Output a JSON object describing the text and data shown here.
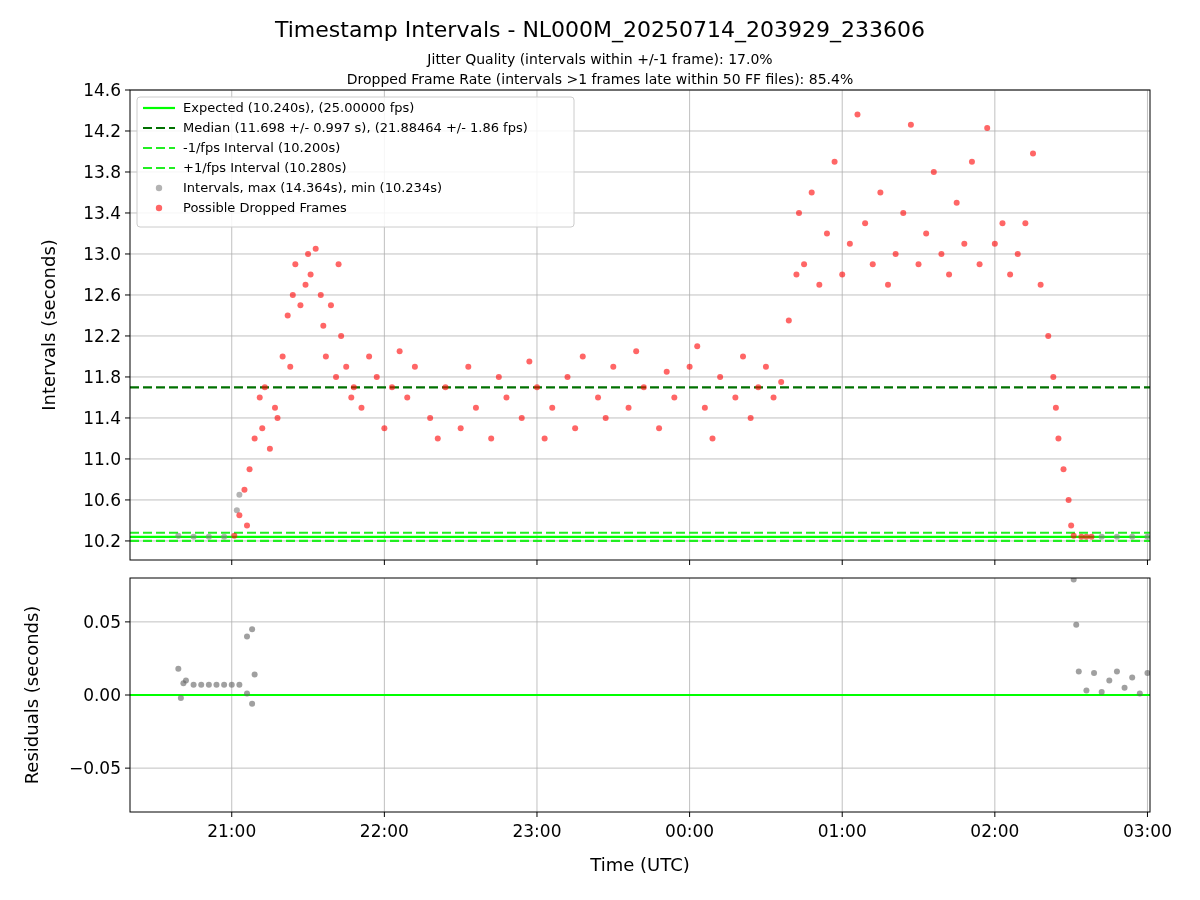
{
  "figure": {
    "title": "Timestamp Intervals - NL000M_20250714_203929_233606",
    "subtitles": [
      "Jitter Quality (intervals within +/-1 frame): 17.0%",
      "Dropped Frame Rate (intervals >1 frames late within 50 FF files): 85.4%"
    ]
  },
  "charts": [
    {
      "chart_data": {
        "type": "scatter",
        "ylabel": "Intervals (seconds)",
        "grid": true,
        "xlim": [
          "2025-07-14T20:20",
          "2025-07-15T03:01"
        ],
        "ylim": [
          10.014,
          14.6
        ],
        "yticks": [
          {
            "value": 10.2,
            "label": "10.2"
          },
          {
            "value": 10.6,
            "label": "10.6"
          },
          {
            "value": 11.0,
            "label": "11.0"
          },
          {
            "value": 11.4,
            "label": "11.4"
          },
          {
            "value": 11.8,
            "label": "11.8"
          },
          {
            "value": 12.2,
            "label": "12.2"
          },
          {
            "value": 12.6,
            "label": "12.6"
          },
          {
            "value": 13.0,
            "label": "13.0"
          },
          {
            "value": 13.4,
            "label": "13.4"
          },
          {
            "value": 13.8,
            "label": "13.8"
          },
          {
            "value": 14.2,
            "label": "14.2"
          },
          {
            "value": 14.6,
            "label": "14.6"
          }
        ],
        "ref_lines": [
          {
            "axis": "y",
            "value": 10.24,
            "label": "Expected (10.240s), (25.00000 fps)",
            "color": "#00ff00"
          },
          {
            "axis": "y",
            "value": 11.698,
            "label": "Median (11.698 +/- 0.997 s), (21.88464 +/- 1.86 fps)",
            "color": "#007000"
          },
          {
            "axis": "y",
            "value": 10.2,
            "label": "-1/fps Interval (10.200s)",
            "color": "#22ee22"
          },
          {
            "axis": "y",
            "value": 10.28,
            "label": "+1/fps Interval (10.280s)",
            "color": "#22ee22"
          }
        ],
        "series": [
          {
            "name": "Intervals, max (14.364s), min (10.234s)",
            "color": "#808080",
            "x": [
              "2025-07-14T20:39",
              "2025-07-14T20:45",
              "2025-07-14T20:51",
              "2025-07-14T20:57",
              "2025-07-14T21:02",
              "2025-07-14T21:03",
              "2025-07-15T02:42",
              "2025-07-15T02:48",
              "2025-07-15T02:54",
              "2025-07-15T03:00"
            ],
            "values": [
              10.25,
              10.24,
              10.24,
              10.24,
              10.5,
              10.65,
              10.24,
              10.24,
              10.24,
              10.24
            ]
          },
          {
            "name": "Possible Dropped Frames",
            "color": "#ff0000",
            "x": [
              "2025-07-14T21:01",
              "2025-07-14T21:03",
              "2025-07-14T21:05",
              "2025-07-14T21:06",
              "2025-07-14T21:07",
              "2025-07-14T21:09",
              "2025-07-14T21:11",
              "2025-07-14T21:12",
              "2025-07-14T21:13",
              "2025-07-14T21:15",
              "2025-07-14T21:17",
              "2025-07-14T21:18",
              "2025-07-14T21:20",
              "2025-07-14T21:22",
              "2025-07-14T21:23",
              "2025-07-14T21:24",
              "2025-07-14T21:25",
              "2025-07-14T21:27",
              "2025-07-14T21:29",
              "2025-07-14T21:30",
              "2025-07-14T21:31",
              "2025-07-14T21:33",
              "2025-07-14T21:35",
              "2025-07-14T21:36",
              "2025-07-14T21:37",
              "2025-07-14T21:39",
              "2025-07-14T21:41",
              "2025-07-14T21:42",
              "2025-07-14T21:43",
              "2025-07-14T21:45",
              "2025-07-14T21:47",
              "2025-07-14T21:48",
              "2025-07-14T21:51",
              "2025-07-14T21:54",
              "2025-07-14T21:57",
              "2025-07-14T22:00",
              "2025-07-14T22:03",
              "2025-07-14T22:06",
              "2025-07-14T22:09",
              "2025-07-14T22:12",
              "2025-07-14T22:18",
              "2025-07-14T22:21",
              "2025-07-14T22:24",
              "2025-07-14T22:30",
              "2025-07-14T22:33",
              "2025-07-14T22:36",
              "2025-07-14T22:42",
              "2025-07-14T22:45",
              "2025-07-14T22:48",
              "2025-07-14T22:54",
              "2025-07-14T22:57",
              "2025-07-14T23:00",
              "2025-07-14T23:03",
              "2025-07-14T23:06",
              "2025-07-14T23:12",
              "2025-07-14T23:15",
              "2025-07-14T23:18",
              "2025-07-14T23:24",
              "2025-07-14T23:27",
              "2025-07-14T23:30",
              "2025-07-14T23:36",
              "2025-07-14T23:39",
              "2025-07-14T23:42",
              "2025-07-14T23:48",
              "2025-07-14T23:51",
              "2025-07-14T23:54",
              "2025-07-15T00:00",
              "2025-07-15T00:03",
              "2025-07-15T00:06",
              "2025-07-15T00:09",
              "2025-07-15T00:12",
              "2025-07-15T00:18",
              "2025-07-15T00:21",
              "2025-07-15T00:24",
              "2025-07-15T00:27",
              "2025-07-15T00:30",
              "2025-07-15T00:33",
              "2025-07-15T00:36",
              "2025-07-15T00:39",
              "2025-07-15T00:42",
              "2025-07-15T00:43",
              "2025-07-15T00:45",
              "2025-07-15T00:48",
              "2025-07-15T00:51",
              "2025-07-15T00:54",
              "2025-07-15T00:57",
              "2025-07-15T01:00",
              "2025-07-15T01:03",
              "2025-07-15T01:06",
              "2025-07-15T01:09",
              "2025-07-15T01:12",
              "2025-07-15T01:15",
              "2025-07-15T01:18",
              "2025-07-15T01:21",
              "2025-07-15T01:24",
              "2025-07-15T01:27",
              "2025-07-15T01:30",
              "2025-07-15T01:33",
              "2025-07-15T01:36",
              "2025-07-15T01:39",
              "2025-07-15T01:42",
              "2025-07-15T01:45",
              "2025-07-15T01:48",
              "2025-07-15T01:51",
              "2025-07-15T01:54",
              "2025-07-15T01:57",
              "2025-07-15T02:00",
              "2025-07-15T02:03",
              "2025-07-15T02:06",
              "2025-07-15T02:09",
              "2025-07-15T02:12",
              "2025-07-15T02:15",
              "2025-07-15T02:18",
              "2025-07-15T02:21",
              "2025-07-15T02:23",
              "2025-07-15T02:24",
              "2025-07-15T02:25",
              "2025-07-15T02:27",
              "2025-07-15T02:29",
              "2025-07-15T02:30",
              "2025-07-15T02:31",
              "2025-07-15T02:34",
              "2025-07-15T02:36",
              "2025-07-15T02:38"
            ],
            "values": [
              10.25,
              10.45,
              10.7,
              10.35,
              10.9,
              11.2,
              11.6,
              11.3,
              11.7,
              11.1,
              11.5,
              11.4,
              12.0,
              12.4,
              11.9,
              12.6,
              12.9,
              12.5,
              12.7,
              13.0,
              12.8,
              13.05,
              12.6,
              12.3,
              12.0,
              12.5,
              11.8,
              12.9,
              12.2,
              11.9,
              11.6,
              11.7,
              11.5,
              12.0,
              11.8,
              11.3,
              11.7,
              12.05,
              11.6,
              11.9,
              11.4,
              11.2,
              11.7,
              11.3,
              11.9,
              11.5,
              11.2,
              11.8,
              11.6,
              11.4,
              11.95,
              11.7,
              11.2,
              11.5,
              11.8,
              11.3,
              12.0,
              11.6,
              11.4,
              11.9,
              11.5,
              12.05,
              11.7,
              11.3,
              11.85,
              11.6,
              11.9,
              12.1,
              11.5,
              11.2,
              11.8,
              11.6,
              12.0,
              11.4,
              11.7,
              11.9,
              11.6,
              11.75,
              12.35,
              12.8,
              13.4,
              12.9,
              13.6,
              12.7,
              13.2,
              13.9,
              12.8,
              13.1,
              14.36,
              13.3,
              12.9,
              13.6,
              12.7,
              13.0,
              13.4,
              14.26,
              12.9,
              13.2,
              13.8,
              13.0,
              12.8,
              13.5,
              13.1,
              13.9,
              12.9,
              14.23,
              13.1,
              13.3,
              12.8,
              13.0,
              13.3,
              13.98,
              12.7,
              12.2,
              11.8,
              11.5,
              11.2,
              10.9,
              10.6,
              10.35,
              10.25,
              10.24,
              10.24,
              10.24
            ]
          }
        ]
      }
    },
    {
      "chart_data": {
        "type": "scatter",
        "xlabel": "Time (UTC)",
        "ylabel": "Residuals (seconds)",
        "grid": true,
        "xlim": [
          "2025-07-14T20:20",
          "2025-07-15T03:01"
        ],
        "ylim": [
          -0.08,
          0.08
        ],
        "xticks": [
          {
            "value": "2025-07-14T21:00",
            "label": "21:00"
          },
          {
            "value": "2025-07-14T22:00",
            "label": "22:00"
          },
          {
            "value": "2025-07-14T23:00",
            "label": "23:00"
          },
          {
            "value": "2025-07-15T00:00",
            "label": "00:00"
          },
          {
            "value": "2025-07-15T01:00",
            "label": "01:00"
          },
          {
            "value": "2025-07-15T02:00",
            "label": "02:00"
          },
          {
            "value": "2025-07-15T03:00",
            "label": "03:00"
          }
        ],
        "yticks": [
          {
            "value": 0.05,
            "label": "0.05"
          },
          {
            "value": 0,
            "label": "0.00"
          },
          {
            "value": -0.05,
            "label": "−0.05"
          }
        ],
        "ref_lines": [
          {
            "axis": "y",
            "value": 0,
            "color": "#00ff00"
          }
        ],
        "series": [
          {
            "color": "#606060",
            "x": [
              "2025-07-14T20:39",
              "2025-07-14T20:40",
              "2025-07-14T20:41",
              "2025-07-14T20:42",
              "2025-07-14T20:45",
              "2025-07-14T20:48",
              "2025-07-14T20:51",
              "2025-07-14T20:54",
              "2025-07-14T20:57",
              "2025-07-14T21:00",
              "2025-07-14T21:03",
              "2025-07-14T21:06",
              "2025-07-14T21:06",
              "2025-07-14T21:08",
              "2025-07-14T21:08",
              "2025-07-14T21:09",
              "2025-07-15T02:31",
              "2025-07-15T02:32",
              "2025-07-15T02:33",
              "2025-07-15T02:36",
              "2025-07-15T02:39",
              "2025-07-15T02:42",
              "2025-07-15T02:45",
              "2025-07-15T02:48",
              "2025-07-15T02:51",
              "2025-07-15T02:54",
              "2025-07-15T02:57",
              "2025-07-15T03:00"
            ],
            "values": [
              0.018,
              -0.002,
              0.008,
              0.01,
              0.007,
              0.007,
              0.007,
              0.007,
              0.007,
              0.007,
              0.007,
              0.001,
              0.04,
              0.045,
              -0.006,
              0.014,
              0.079,
              0.048,
              0.016,
              0.003,
              0.015,
              0.002,
              0.01,
              0.016,
              0.005,
              0.012,
              0.001,
              0.015
            ]
          }
        ]
      }
    }
  ]
}
